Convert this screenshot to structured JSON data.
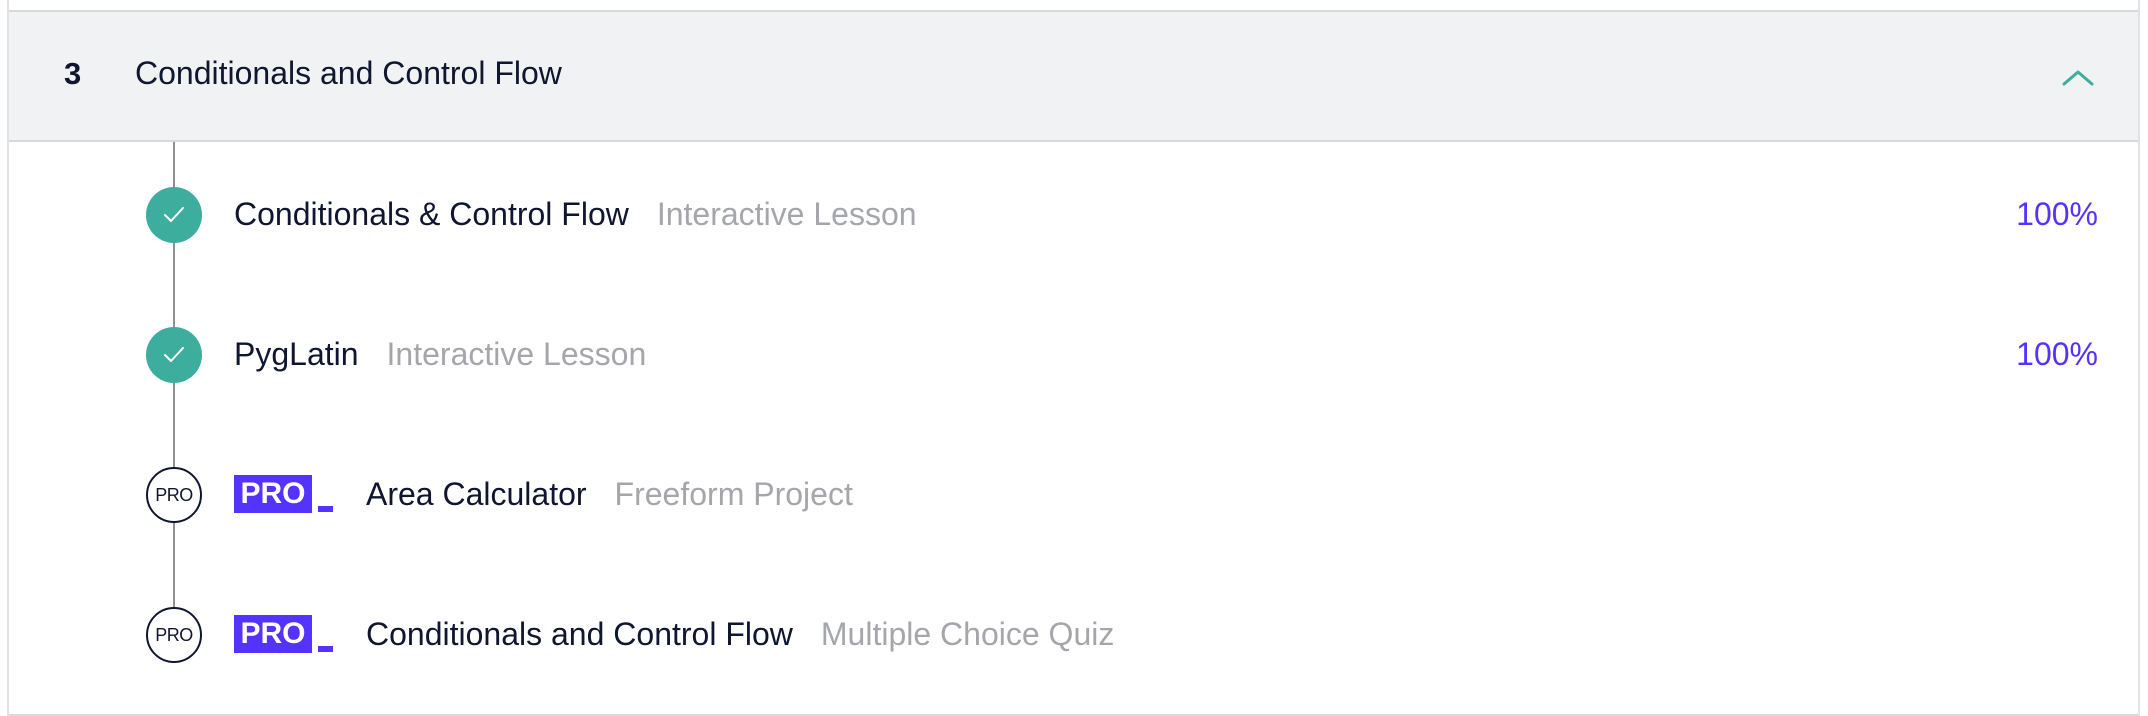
{
  "module": {
    "number": "3",
    "title": "Conditionals and Control Flow",
    "expanded": true,
    "accent_color": "#3dae9e"
  },
  "items": [
    {
      "status": "complete",
      "title": "Conditionals & Control Flow",
      "type": "Interactive Lesson",
      "percent": "100%"
    },
    {
      "status": "complete",
      "title": "PygLatin",
      "type": "Interactive Lesson",
      "percent": "100%"
    },
    {
      "status": "pro",
      "status_label": "PRO",
      "badge": "PRO",
      "title": "Area Calculator",
      "type": "Freeform Project"
    },
    {
      "status": "pro",
      "status_label": "PRO",
      "badge": "PRO",
      "title": "Conditionals and Control Flow",
      "type": "Multiple Choice Quiz"
    }
  ],
  "colors": {
    "pro_purple": "#5533ff",
    "complete_teal": "#3dae9e",
    "text_dark": "#10162f",
    "text_muted": "#a5a6ab"
  },
  "icons": {
    "collapse": "chevron-up-icon",
    "complete": "checkmark-icon"
  }
}
